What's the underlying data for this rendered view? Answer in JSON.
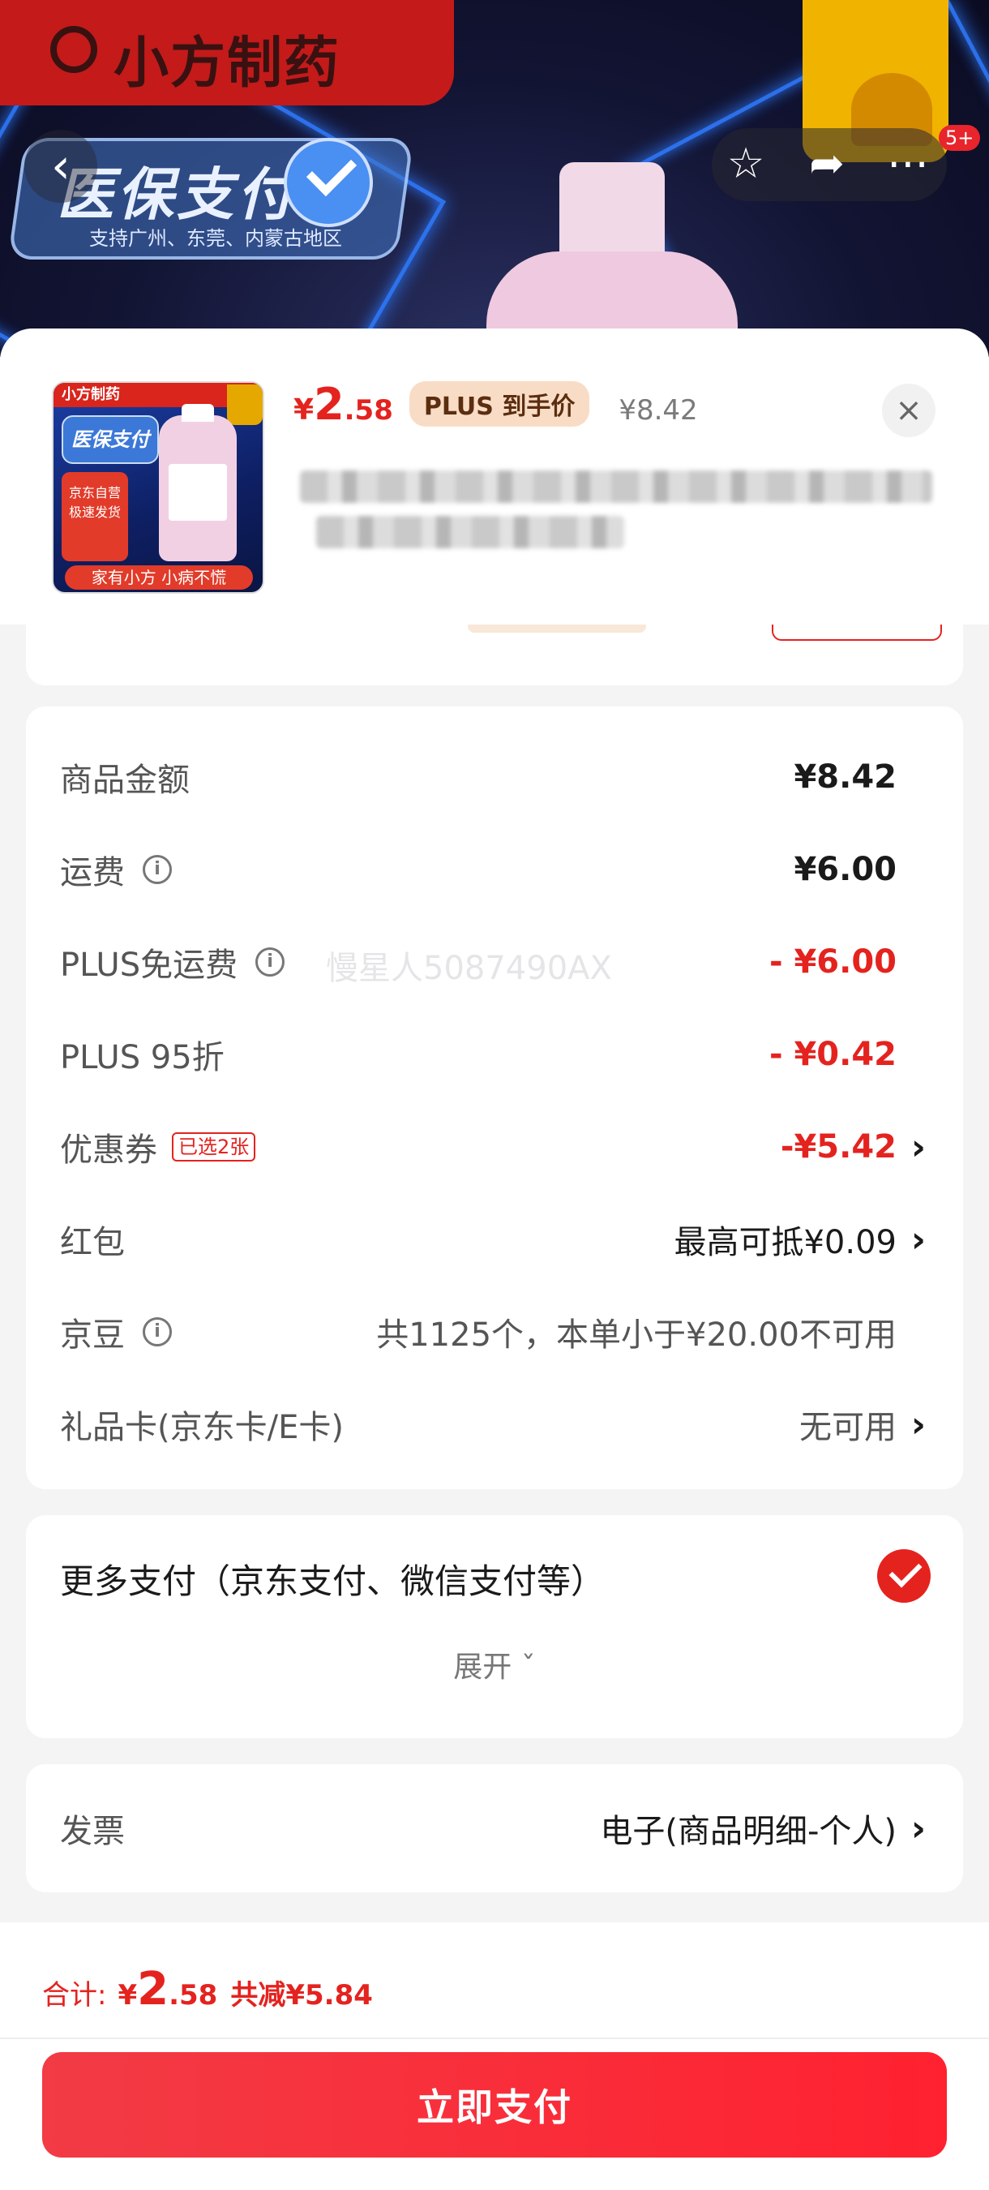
{
  "backdrop": {
    "brand": "小方制药",
    "badge_title": "医保支付",
    "badge_subtitle": "支持广州、东莞、内蒙古地区",
    "cart_count": "5+",
    "icons": [
      "back-icon",
      "star-icon",
      "share-icon",
      "more-icon"
    ]
  },
  "product": {
    "thumb_brand": "小方制药",
    "thumb_badge": "医保支付",
    "thumb_promo": "京东自营 极速发货",
    "thumb_slogan": "家有小方 小病不慌",
    "price_symbol": "¥",
    "price_int": "2",
    "price_dec": ".58",
    "plus_tag": "PLUS 到手价",
    "original_price": "¥8.42",
    "close_icon": "×"
  },
  "costs": {
    "rows": [
      {
        "label": "商品金额",
        "value": "¥8.42"
      },
      {
        "label": "运费",
        "value": "¥6.00"
      },
      {
        "label": "PLUS免运费",
        "value": "- ¥6.00"
      },
      {
        "label": "PLUS 95折",
        "value": "- ¥0.42"
      },
      {
        "label": "优惠券",
        "tag": "已选2张",
        "value": "-¥5.42"
      },
      {
        "label": "红包",
        "value": "最高可抵¥0.09"
      },
      {
        "label": "京豆",
        "value": "共1125个，本单小于¥20.00不可用"
      },
      {
        "label": "礼品卡(京东卡/E卡)",
        "value": "无可用"
      }
    ],
    "info_glyph": "i",
    "chevron": "›",
    "watermark": "慢星人5087490AX"
  },
  "payment": {
    "title": "更多支付（京东支付、微信支付等）",
    "expand": "展开 ˇ"
  },
  "invoice": {
    "label": "发票",
    "value": "电子(商品明细-个人)"
  },
  "footer": {
    "total_label": "合计:",
    "total_symbol": "¥",
    "total_int": "2",
    "total_dec": ".58",
    "total_saving": "共减¥5.84",
    "pay_button": "立即支付"
  },
  "colors": {
    "accent_red": "#e4231f",
    "plus_tag_bg": "#f9dcc6",
    "page_bg": "#f4f4f4"
  }
}
